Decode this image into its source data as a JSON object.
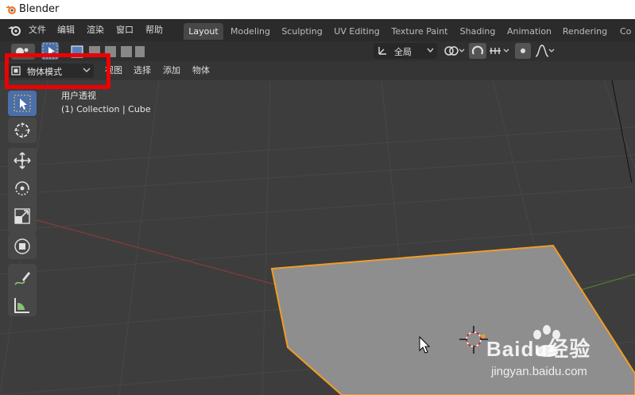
{
  "window": {
    "title": "Blender"
  },
  "menu": {
    "items": [
      "文件",
      "编辑",
      "渲染",
      "窗口",
      "帮助"
    ]
  },
  "workspaces": [
    {
      "label": "Layout",
      "active": true
    },
    {
      "label": "Modeling",
      "active": false
    },
    {
      "label": "Sculpting",
      "active": false
    },
    {
      "label": "UV Editing",
      "active": false
    },
    {
      "label": "Texture Paint",
      "active": false
    },
    {
      "label": "Shading",
      "active": false
    },
    {
      "label": "Animation",
      "active": false
    },
    {
      "label": "Rendering",
      "active": false
    },
    {
      "label": "Co",
      "active": false
    }
  ],
  "header": {
    "transform_orientation": "全局",
    "mode": "物体模式",
    "view_menu": "视图",
    "select_menu": "选择",
    "add_menu": "添加",
    "object_menu": "物体"
  },
  "viewport": {
    "view_name": "用户透视",
    "collection_info": "(1) Collection | Cube"
  },
  "watermark": {
    "brand": "Baidu经验",
    "url": "jingyan.baidu.com"
  },
  "colors": {
    "accent": "#4b6fa9",
    "highlight_red": "#ef0000",
    "selection_orange": "#f39c26",
    "mesh_face": "#8e8e8e"
  }
}
